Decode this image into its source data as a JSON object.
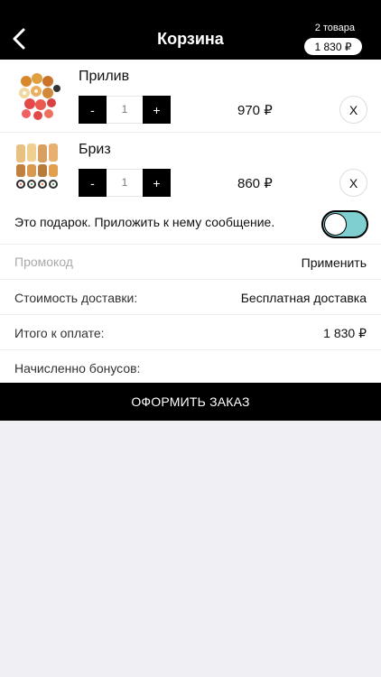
{
  "header": {
    "title": "Корзина",
    "item_count": "2 товара",
    "total": "1 830 ₽"
  },
  "items": [
    {
      "name": "Прилив",
      "quantity": "1",
      "price": "970 ₽",
      "minus": "-",
      "plus": "+",
      "remove": "X"
    },
    {
      "name": "Бриз",
      "quantity": "1",
      "price": "860 ₽",
      "minus": "-",
      "plus": "+",
      "remove": "X"
    }
  ],
  "gift": {
    "label": "Это подарок. Приложить к нему сообщение.",
    "enabled": true
  },
  "promo": {
    "placeholder": "Промокод",
    "apply_label": "Применить"
  },
  "delivery": {
    "label": "Стоимость доставки:",
    "value": "Бесплатная доставка"
  },
  "total": {
    "label": "Итого к оплате:",
    "value": "1 830 ₽"
  },
  "bonus": {
    "label": "Начисленно бонусов:",
    "value": ""
  },
  "checkout": {
    "label": "ОФОРМИТЬ ЗАКАЗ"
  },
  "colors": {
    "header_bg": "#000000",
    "toggle_on": "#7fcfd0",
    "page_bg": "#efeff4"
  },
  "icons": [
    "chevron-left-icon",
    "sushi-set-image"
  ]
}
